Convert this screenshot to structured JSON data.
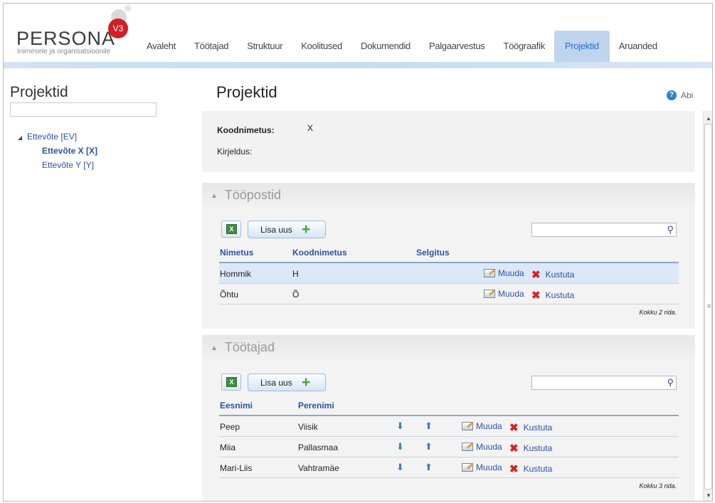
{
  "app": {
    "logo_text": "PERSONA",
    "logo_version": "V3",
    "logo_tagline": "Inimesele ja organisatsioonile"
  },
  "nav": {
    "tabs": [
      {
        "label": "Avaleht"
      },
      {
        "label": "Töötajad"
      },
      {
        "label": "Struktuur"
      },
      {
        "label": "Koolitused"
      },
      {
        "label": "Dokumendid"
      },
      {
        "label": "Palgaarvestus"
      },
      {
        "label": "Töögraafik"
      },
      {
        "label": "Projektid",
        "active": true
      },
      {
        "label": "Aruanded"
      }
    ]
  },
  "sidebar": {
    "title": "Projektid",
    "search_value": "",
    "tree": {
      "root": "Ettevõte [EV]",
      "children": [
        {
          "label": "Ettevõte X [X]",
          "selected": true
        },
        {
          "label": "Ettevõte Y [Y]",
          "selected": false
        }
      ]
    }
  },
  "main": {
    "title": "Projektid",
    "help_label": "Abi",
    "info": {
      "koodnimetus_label": "Koodnimetus:",
      "koodnimetus_value": "X",
      "kirjeldus_label": "Kirjeldus:",
      "kirjeldus_value": ""
    }
  },
  "toopostid": {
    "title": "Tööpostid",
    "add_label": "Lisa uus",
    "search_value": "",
    "columns": {
      "nimetus": "Nimetus",
      "koodnimetus": "Koodnimetus",
      "selgitus": "Selgitus"
    },
    "rows": [
      {
        "nimetus": "Hommik",
        "koodnimetus": "H",
        "selgitus": "",
        "edit": "Muuda",
        "delete": "Kustuta"
      },
      {
        "nimetus": "Õhtu",
        "koodnimetus": "Õ",
        "selgitus": "",
        "edit": "Muuda",
        "delete": "Kustuta"
      }
    ],
    "total": "Kokku 2 rida."
  },
  "tootajad": {
    "title": "Töötajad",
    "add_label": "Lisa uus",
    "search_value": "",
    "columns": {
      "eesnimi": "Eesnimi",
      "perenimi": "Perenimi"
    },
    "rows": [
      {
        "eesnimi": "Peep",
        "perenimi": "Viisik",
        "edit": "Muuda",
        "delete": "Kustuta"
      },
      {
        "eesnimi": "Miia",
        "perenimi": "Pallasmaa",
        "edit": "Muuda",
        "delete": "Kustuta"
      },
      {
        "eesnimi": "Mari-Liis",
        "perenimi": "Vahtramäe",
        "edit": "Muuda",
        "delete": "Kustuta"
      }
    ],
    "total": "Kokku 3 rida."
  },
  "colors": {
    "accent": "#2a6ed0",
    "link": "#2b52a6",
    "active_tab_bg": "#bfd4ee",
    "delete_red": "#d62222",
    "add_green": "#3aa935"
  }
}
